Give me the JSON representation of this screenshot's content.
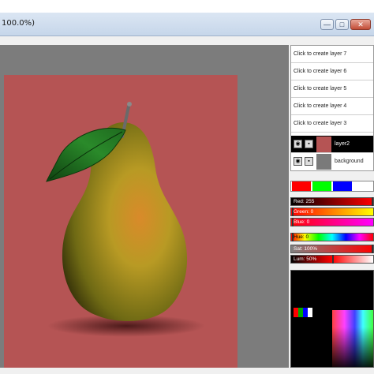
{
  "window": {
    "title": "100.0%)",
    "controls": {
      "minimize": "—",
      "maximize": "□",
      "close": "✕"
    }
  },
  "layers": {
    "items": [
      {
        "label": "Click to create layer 7"
      },
      {
        "label": "Click to create layer 6"
      },
      {
        "label": "Click to create layer 5"
      },
      {
        "label": "Click to create layer 4"
      },
      {
        "label": "Click to create layer 3"
      },
      {
        "label": "layer2",
        "active": true
      },
      {
        "label": "background"
      }
    ]
  },
  "swatches": [
    "#ff0000",
    "#00ff00",
    "#0000ff",
    "#ffffff"
  ],
  "sliders": {
    "red": "Red: 255",
    "green": "Green: 0",
    "blue": "Blue: 0",
    "hue": "Hue: 0",
    "sat": "Sat: 100%",
    "lum": "Lum: 50%"
  },
  "colors": {
    "canvas_bg": "#b55454",
    "workspace": "#7c7c7c",
    "pear": "#9c8a1e",
    "leaf": "#1f6a1f"
  }
}
